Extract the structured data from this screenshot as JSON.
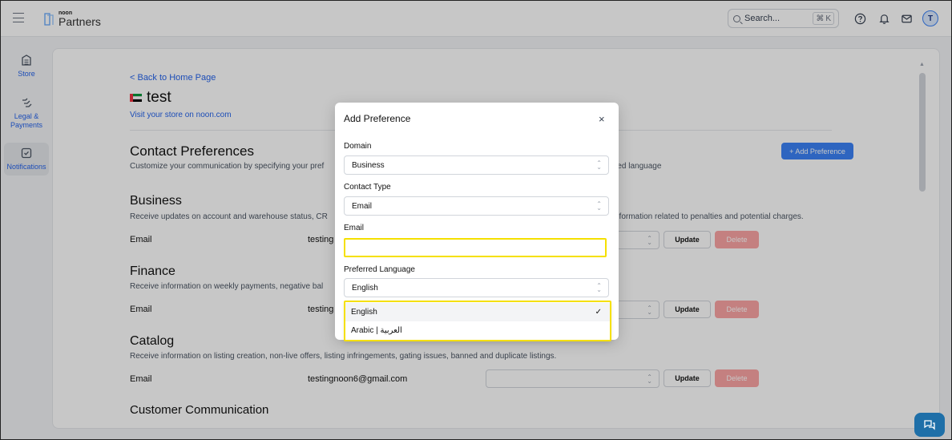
{
  "header": {
    "logo_small": "noon",
    "logo_big": "Partners",
    "search_placeholder": "Search...",
    "shortcut_key": "K",
    "avatar_initial": "T"
  },
  "sidebar": {
    "items": [
      {
        "label": "Store",
        "icon": "store-icon"
      },
      {
        "label": "Legal & Payments",
        "icon": "legal-payments-icon"
      },
      {
        "label": "Notifications",
        "icon": "notifications-icon",
        "active": true
      }
    ]
  },
  "page": {
    "back_link": "< Back to Home Page",
    "store_name": "test",
    "visit_link": "Visit your store on noon.com",
    "contact_title": "Contact Preferences",
    "contact_desc_left": "Customize your communication by specifying your pref",
    "contact_desc_right": "red language",
    "add_preference": "+ Add Preference",
    "sections": [
      {
        "title": "Business",
        "desc_left": "Receive updates on account and warehouse status, CR",
        "desc_right": "nformation related to penalties and potential charges.",
        "row_label": "Email",
        "row_value": "testing"
      },
      {
        "title": "Finance",
        "desc_left": "Receive information on weekly payments, negative bal",
        "desc_right": "",
        "row_label": "Email",
        "row_value": "testing"
      },
      {
        "title": "Catalog",
        "desc_left": "Receive information on listing creation, non-live offers, listing infringements, gating issues, banned and duplicate listings.",
        "desc_right": "",
        "row_label": "Email",
        "row_value": "testingnoon6@gmail.com"
      },
      {
        "title": "Customer Communication"
      }
    ],
    "update_label": "Update",
    "delete_label": "Delete"
  },
  "modal": {
    "title": "Add Preference",
    "close": "×",
    "domain_label": "Domain",
    "domain_value": "Business",
    "contact_type_label": "Contact Type",
    "contact_type_value": "Email",
    "email_label": "Email",
    "email_value": "",
    "language_label": "Preferred Language",
    "language_value": "English",
    "language_options": [
      "English",
      "Arabic | العربية"
    ],
    "selected_check": "✓"
  },
  "colors": {
    "accent": "#3b82f6",
    "highlight": "#f5e000",
    "delete": "#fca5a5",
    "chat": "#1e6fa8"
  }
}
